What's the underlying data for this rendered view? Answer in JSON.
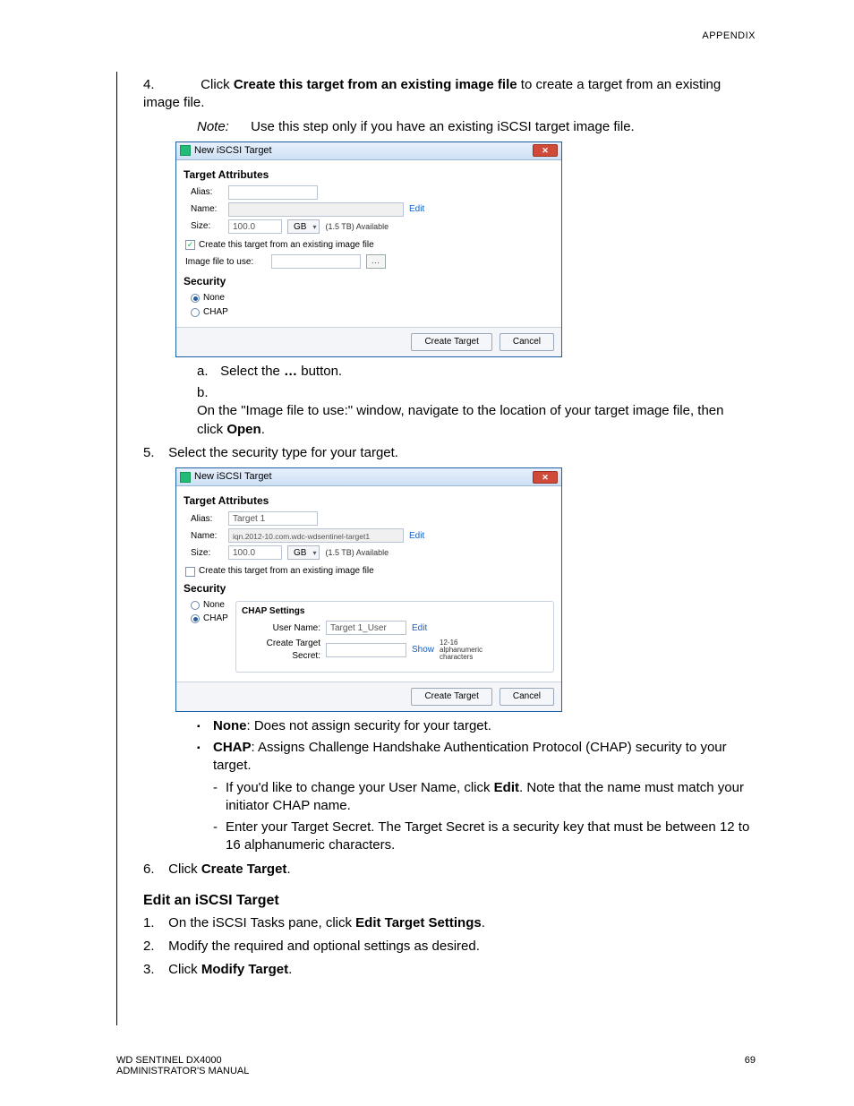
{
  "header": {
    "section": "APPENDIX"
  },
  "step4": {
    "num": "4.",
    "pre": "Click ",
    "bold": "Create this target from an existing image file",
    "post": " to create a target from an existing image file."
  },
  "note": {
    "label": "Note:",
    "text": "Use this step only if you have an existing iSCSI target image file."
  },
  "dialog1": {
    "title": "New iSCSI Target",
    "ta": "Target Attributes",
    "alias_l": "Alias:",
    "name_l": "Name:",
    "edit": "Edit",
    "size_l": "Size:",
    "size_v": "100.0",
    "unit": "GB",
    "avail": "(1.5 TB) Available",
    "chk_label": "Create this target from an existing image file",
    "img_l": "Image file to use:",
    "browse": "...",
    "sec": "Security",
    "none": "None",
    "chap": "CHAP",
    "create": "Create Target",
    "cancel": "Cancel"
  },
  "sub_a": {
    "num": "a.",
    "pre": "Select the ",
    "bold": "…",
    "post": " button."
  },
  "sub_b": {
    "num": "b.",
    "pre": "On the \"Image file to use:\" window, navigate to the location of your target image file, then click ",
    "bold": "Open",
    "post": "."
  },
  "step5": {
    "num": "5.",
    "text": "Select the security type for your target."
  },
  "dialog2": {
    "title": "New iSCSI Target",
    "ta": "Target Attributes",
    "alias_l": "Alias:",
    "alias_v": "Target 1",
    "name_l": "Name:",
    "name_v": "iqn.2012-10.com.wdc-wdsentinel-target1",
    "edit": "Edit",
    "size_l": "Size:",
    "size_v": "100.0",
    "unit": "GB",
    "avail": "(1.5 TB) Available",
    "chk_label": "Create this target from an existing image file",
    "sec": "Security",
    "none": "None",
    "chap": "CHAP",
    "chap_title": "CHAP Settings",
    "user_l": "User Name:",
    "user_v": "Target 1_User",
    "sec_l": "Create Target Secret:",
    "show": "Show",
    "hint": "12-16 alphanumeric characters",
    "create": "Create Target",
    "cancel": "Cancel"
  },
  "bullets": {
    "none_b": "None",
    "none_t": ": Does not assign security for your target.",
    "chap_b": "CHAP",
    "chap_t": ": Assigns Challenge Handshake Authentication Protocol (CHAP) security to your target.",
    "d1_pre": "If you'd like to change your User Name, click ",
    "d1_b": "Edit",
    "d1_post": ". Note that the name must match your initiator CHAP name.",
    "d2": "Enter your Target Secret. The Target Secret is a security key that must be between 12 to 16 alphanumeric characters."
  },
  "step6": {
    "num": "6.",
    "pre": "Click ",
    "bold": "Create Target",
    "post": "."
  },
  "edit_section": {
    "heading": "Edit an iSCSI Target",
    "s1": {
      "num": "1.",
      "pre": "On the iSCSI Tasks pane, click ",
      "bold": "Edit Target Settings",
      "post": "."
    },
    "s2": {
      "num": "2.",
      "text": "Modify the required and optional settings as desired."
    },
    "s3": {
      "num": "3.",
      "pre": "Click ",
      "bold": "Modify Target",
      "post": "."
    }
  },
  "footer": {
    "left": "WD SENTINEL DX4000\nADMINISTRATOR'S MANUAL",
    "page": "69"
  }
}
